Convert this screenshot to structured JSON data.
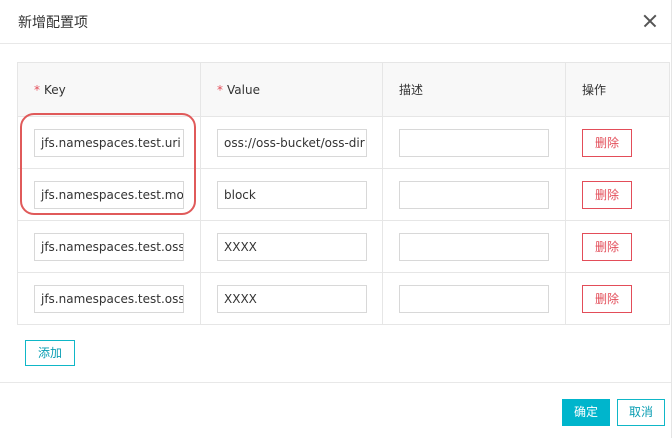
{
  "dialog": {
    "title": "新增配置项"
  },
  "table": {
    "headers": {
      "key": "Key",
      "value": "Value",
      "desc": "描述",
      "action": "操作"
    },
    "required_mark": "*",
    "rows": [
      {
        "key": "jfs.namespaces.test.uri",
        "value": "oss://oss-bucket/oss-dir",
        "desc": "",
        "delete_label": "删除"
      },
      {
        "key": "jfs.namespaces.test.mode",
        "value": "block",
        "desc": "",
        "delete_label": "删除"
      },
      {
        "key": "jfs.namespaces.test.oss.accessKeyId",
        "value": "XXXX",
        "desc": "",
        "delete_label": "删除"
      },
      {
        "key": "jfs.namespaces.test.oss.accessKeySecret",
        "value": "XXXX",
        "desc": "",
        "delete_label": "删除"
      }
    ]
  },
  "add_label": "添加",
  "footer": {
    "ok_label": "确定",
    "cancel_label": "取消"
  },
  "colors": {
    "accent": "#00b5cc",
    "danger": "#e34d59",
    "highlight": "#e05a5a"
  }
}
